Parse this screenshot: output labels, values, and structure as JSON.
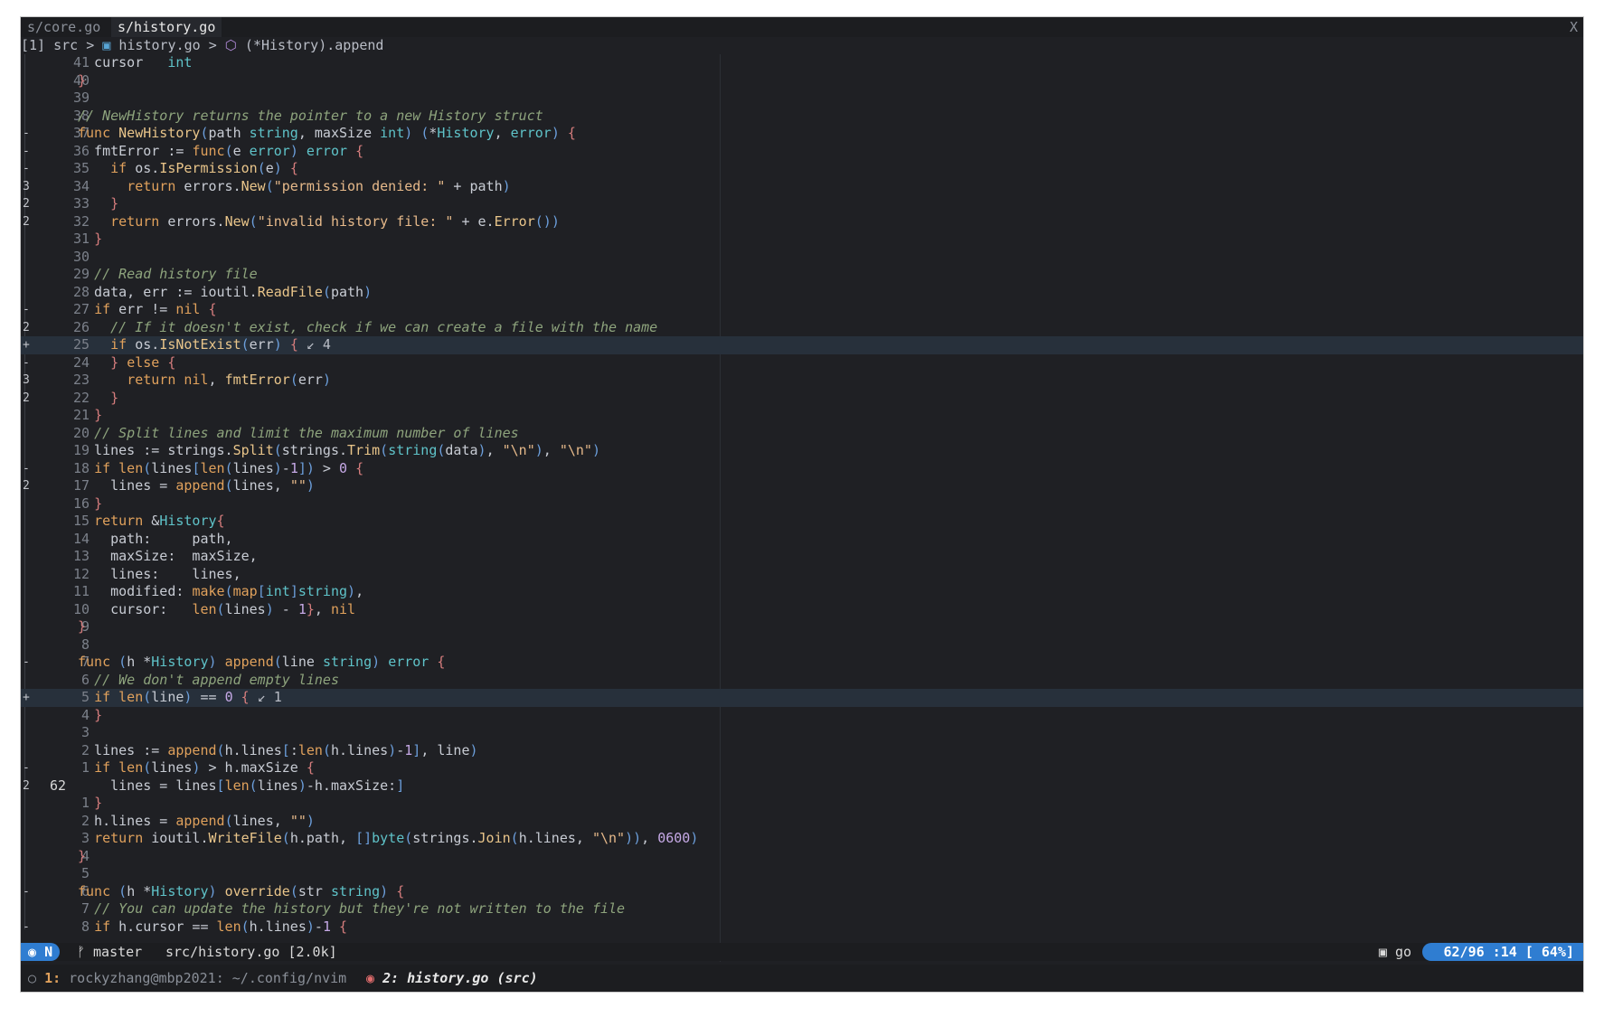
{
  "tabs": [
    {
      "label": "s/core.go",
      "active": false
    },
    {
      "label": "s/history.go",
      "active": true
    }
  ],
  "close_label": "X",
  "winbar": {
    "buffer": "[1]",
    "crumbs": [
      "src",
      "history.go",
      "(*History).append"
    ]
  },
  "status": {
    "mode": "N",
    "branch": "master",
    "file": "src/history.go [2.0k]",
    "filetype": "go",
    "position": "62/96 :14 [ 64%]"
  },
  "tmux": {
    "w1_index": "1:",
    "w1_label": "rockyzhang@mbp2021: ~/.config/nvim",
    "w2_label": "2: history.go (src)"
  },
  "lines": [
    {
      "n": "41",
      "s": "",
      "t": "  cursor   int"
    },
    {
      "n": "40",
      "s": "",
      "t": "}"
    },
    {
      "n": "39",
      "s": "",
      "t": ""
    },
    {
      "n": "38",
      "s": "",
      "t": "// NewHistory returns the pointer to a new History struct"
    },
    {
      "n": "37",
      "s": "-",
      "t": "func NewHistory(path string, maxSize int) (*History, error) {"
    },
    {
      "n": "36",
      "s": "-",
      "t": "  fmtError := func(e error) error {"
    },
    {
      "n": "35",
      "s": "-",
      "t": "    if os.IsPermission(e) {"
    },
    {
      "n": "34",
      "s": "3",
      "t": "      return errors.New(\"permission denied: \" + path)"
    },
    {
      "n": "33",
      "s": "2",
      "t": "    }"
    },
    {
      "n": "32",
      "s": "2",
      "t": "    return errors.New(\"invalid history file: \" + e.Error())"
    },
    {
      "n": "31",
      "s": "",
      "t": "  }"
    },
    {
      "n": "30",
      "s": "",
      "t": ""
    },
    {
      "n": "29",
      "s": "",
      "t": "  // Read history file"
    },
    {
      "n": "28",
      "s": "",
      "t": "  data, err := ioutil.ReadFile(path)"
    },
    {
      "n": "27",
      "s": "-",
      "t": "  if err != nil {"
    },
    {
      "n": "26",
      "s": "2",
      "t": "    // If it doesn't exist, check if we can create a file with the name"
    },
    {
      "n": "25",
      "s": "+",
      "t": "    if os.IsNotExist(err) { ↙ 4"
    },
    {
      "n": "24",
      "s": "-",
      "t": "    } else {"
    },
    {
      "n": "23",
      "s": "3",
      "t": "      return nil, fmtError(err)"
    },
    {
      "n": "22",
      "s": "2",
      "t": "    }"
    },
    {
      "n": "21",
      "s": "",
      "t": "  }"
    },
    {
      "n": "20",
      "s": "",
      "t": "  // Split lines and limit the maximum number of lines"
    },
    {
      "n": "19",
      "s": "",
      "t": "  lines := strings.Split(strings.Trim(string(data), \"\\n\"), \"\\n\")"
    },
    {
      "n": "18",
      "s": "-",
      "t": "  if len(lines[len(lines)-1]) > 0 {"
    },
    {
      "n": "17",
      "s": "2",
      "t": "    lines = append(lines, \"\")"
    },
    {
      "n": "16",
      "s": "",
      "t": "  }"
    },
    {
      "n": "15",
      "s": "",
      "t": "  return &History{"
    },
    {
      "n": "14",
      "s": "",
      "t": "    path:     path,"
    },
    {
      "n": "13",
      "s": "",
      "t": "    maxSize:  maxSize,"
    },
    {
      "n": "12",
      "s": "",
      "t": "    lines:    lines,"
    },
    {
      "n": "11",
      "s": "",
      "t": "    modified: make(map[int]string),"
    },
    {
      "n": "10",
      "s": "",
      "t": "    cursor:   len(lines) - 1}, nil"
    },
    {
      "n": "9",
      "s": "",
      "t": "}"
    },
    {
      "n": "8",
      "s": "",
      "t": ""
    },
    {
      "n": "7",
      "s": "-",
      "t": "func (h *History) append(line string) error {"
    },
    {
      "n": "6",
      "s": "",
      "t": "  // We don't append empty lines"
    },
    {
      "n": "5",
      "s": "+",
      "t": "  if len(line) == 0 { ↙ 1"
    },
    {
      "n": "4",
      "s": "",
      "t": "  }"
    },
    {
      "n": "3",
      "s": "",
      "t": ""
    },
    {
      "n": "2",
      "s": "",
      "t": "  lines := append(h.lines[:len(h.lines)-1], line)"
    },
    {
      "n": "1",
      "s": "-",
      "t": "  if len(lines) > h.maxSize {"
    },
    {
      "n": "62",
      "s": "2",
      "t": "    lines = lines[len(lines)-h.maxSize:]"
    },
    {
      "n": "1",
      "s": "",
      "t": "  }"
    },
    {
      "n": "2",
      "s": "",
      "t": "  h.lines = append(lines, \"\")"
    },
    {
      "n": "3",
      "s": "",
      "t": "  return ioutil.WriteFile(h.path, []byte(strings.Join(h.lines, \"\\n\")), 0600)"
    },
    {
      "n": "4",
      "s": "",
      "t": "}"
    },
    {
      "n": "5",
      "s": "",
      "t": ""
    },
    {
      "n": "6",
      "s": "-",
      "t": "func (h *History) override(str string) {"
    },
    {
      "n": "7",
      "s": "",
      "t": "  // You can update the history but they're not written to the file"
    },
    {
      "n": "8",
      "s": "-",
      "t": "  if h.cursor == len(h.lines)-1 {"
    }
  ]
}
